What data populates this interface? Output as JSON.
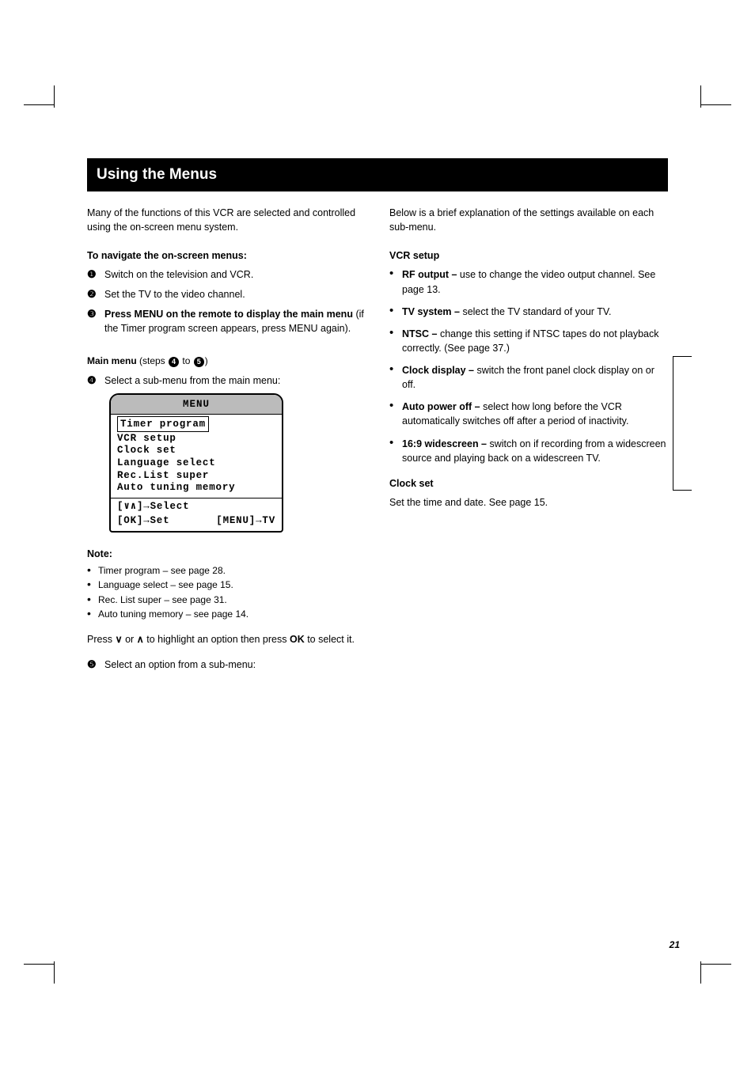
{
  "page_number": "21",
  "header": "Using the Menus",
  "intro": "Many of the functions of this VCR are selected and controlled using the on-screen menu system.",
  "section_title": "To navigate the on-screen menus:",
  "steps": [
    {
      "num": "❶",
      "head": "Switch on the television and VCR."
    },
    {
      "num": "❷",
      "head": "Set the TV to the video channel."
    },
    {
      "num": "❸",
      "head": "Press MENU on the remote to display the main menu ",
      "sub": "(if the Timer program screen appears, press MENU again)."
    }
  ],
  "caption_prefix": "Main menu",
  "caption_suffix": " (steps ",
  "caption_mid": " to ",
  "caption_end": ")",
  "step4": {
    "num": "❹",
    "head": "Select a sub-menu from the main menu:"
  },
  "osd": {
    "title": "MENU",
    "selected": "Timer program",
    "items": [
      "VCR setup",
      "Clock set",
      "Language select",
      "Rec.List super",
      "Auto tuning memory"
    ],
    "footer_left_prefix": "[",
    "footer_left_arrows": "∨∧",
    "footer_left_suffix": "]→Select",
    "footer_mid": "[OK]→Set",
    "footer_right": "[MENU]→TV"
  },
  "note": {
    "title": "Note:",
    "items": [
      "Timer program – see page 28.",
      "Language select – see page 15.",
      "Rec. List super – see page 31.",
      "Auto tuning memory – see page 14."
    ]
  },
  "nav_text_1": "Press ",
  "nav_text_2": " or ",
  "nav_text_3": " to highlight an option then press ",
  "nav_text_ok": "OK",
  "nav_text_4": " to select it.",
  "step5": {
    "num": "❺",
    "head": "Select an option from a sub-menu:"
  },
  "right_intro": "Below is a brief explanation of the settings available on each sub-menu.",
  "right_heading_vcr": "VCR setup",
  "right_items": [
    {
      "head": "RF output – ",
      "body": "use to change the video output channel. See page 13."
    },
    {
      "head": "TV system – ",
      "body": "select the TV standard of your TV."
    },
    {
      "head": "NTSC – ",
      "body": "change this setting if NTSC tapes do not playback correctly. (See page 37.)"
    },
    {
      "head": "Clock display – ",
      "body": "switch the front panel clock display on or off."
    },
    {
      "head": "Auto power off – ",
      "body": "select how long before the VCR automatically switches off after a period of inactivity."
    },
    {
      "head": "16:9 widescreen – ",
      "body": "switch on if recording from a widescreen source and playing back on a widescreen TV."
    }
  ],
  "right_heading_clock": "Clock set",
  "right_clock_body": "Set the time and date. See page 15."
}
